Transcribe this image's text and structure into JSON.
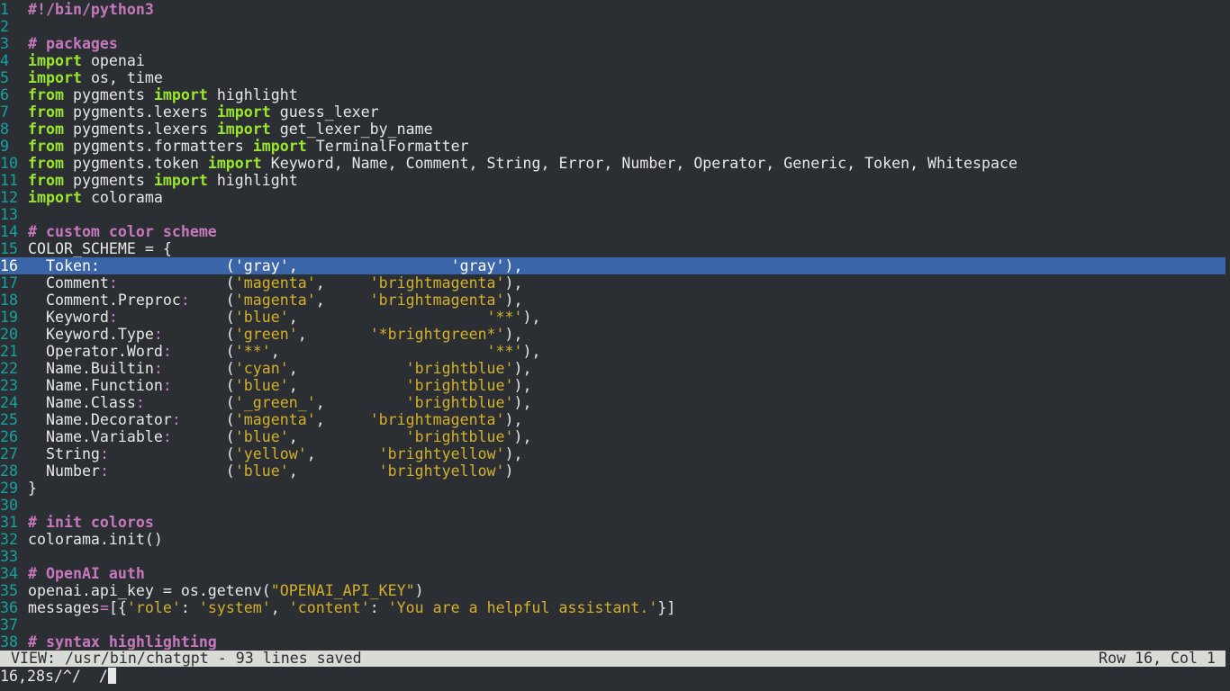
{
  "editor": {
    "current_line": 16,
    "lines": [
      {
        "n": "1",
        "tokens": [
          [
            "comment",
            "#!/bin/python3"
          ]
        ]
      },
      {
        "n": "2",
        "tokens": []
      },
      {
        "n": "3",
        "tokens": [
          [
            "comment",
            "# packages"
          ]
        ]
      },
      {
        "n": "4",
        "tokens": [
          [
            "kw",
            "import"
          ],
          [
            "plain",
            " openai"
          ]
        ]
      },
      {
        "n": "5",
        "tokens": [
          [
            "kw",
            "import"
          ],
          [
            "plain",
            " os, time"
          ]
        ]
      },
      {
        "n": "6",
        "tokens": [
          [
            "kw",
            "from"
          ],
          [
            "plain",
            " pygments "
          ],
          [
            "kw",
            "import"
          ],
          [
            "plain",
            " highlight"
          ]
        ]
      },
      {
        "n": "7",
        "tokens": [
          [
            "kw",
            "from"
          ],
          [
            "plain",
            " pygments.lexers "
          ],
          [
            "kw",
            "import"
          ],
          [
            "plain",
            " guess_lexer"
          ]
        ]
      },
      {
        "n": "8",
        "tokens": [
          [
            "kw",
            "from"
          ],
          [
            "plain",
            " pygments.lexers "
          ],
          [
            "kw",
            "import"
          ],
          [
            "plain",
            " get_lexer_by_name"
          ]
        ]
      },
      {
        "n": "9",
        "tokens": [
          [
            "kw",
            "from"
          ],
          [
            "plain",
            " pygments.formatters "
          ],
          [
            "kw",
            "import"
          ],
          [
            "plain",
            " TerminalFormatter"
          ]
        ]
      },
      {
        "n": "10",
        "tokens": [
          [
            "kw",
            "from"
          ],
          [
            "plain",
            " pygments.token "
          ],
          [
            "kw",
            "import"
          ],
          [
            "plain",
            " Keyword, Name, Comment, String, Error, Number, Operator, Generic, Token, Whitespace"
          ]
        ]
      },
      {
        "n": "11",
        "tokens": [
          [
            "kw",
            "from"
          ],
          [
            "plain",
            " pygments "
          ],
          [
            "kw",
            "import"
          ],
          [
            "plain",
            " highlight"
          ]
        ]
      },
      {
        "n": "12",
        "tokens": [
          [
            "kw",
            "import"
          ],
          [
            "plain",
            " colorama"
          ]
        ]
      },
      {
        "n": "13",
        "tokens": []
      },
      {
        "n": "14",
        "tokens": [
          [
            "comment",
            "# custom color scheme"
          ]
        ]
      },
      {
        "n": "15",
        "tokens": [
          [
            "plain",
            "COLOR_SCHEME = {"
          ]
        ]
      },
      {
        "n": "16",
        "tokens": [
          [
            "plain",
            "  Token:"
          ],
          [
            "plain",
            "              ("
          ],
          [
            "str",
            "'gray'"
          ],
          [
            "plain",
            ",                 "
          ],
          [
            "str",
            "'gray'"
          ],
          [
            "plain",
            "),"
          ]
        ]
      },
      {
        "n": "17",
        "tokens": [
          [
            "plain",
            "  Comment"
          ],
          [
            "punct",
            ":"
          ],
          [
            "plain",
            "            ("
          ],
          [
            "str",
            "'magenta'"
          ],
          [
            "plain",
            ",     "
          ],
          [
            "str",
            "'brightmagenta'"
          ],
          [
            "plain",
            "),"
          ]
        ]
      },
      {
        "n": "18",
        "tokens": [
          [
            "plain",
            "  Comment.Preproc"
          ],
          [
            "punct",
            ":"
          ],
          [
            "plain",
            "    ("
          ],
          [
            "str",
            "'magenta'"
          ],
          [
            "plain",
            ",     "
          ],
          [
            "str",
            "'brightmagenta'"
          ],
          [
            "plain",
            "),"
          ]
        ]
      },
      {
        "n": "19",
        "tokens": [
          [
            "plain",
            "  Keyword"
          ],
          [
            "punct",
            ":"
          ],
          [
            "plain",
            "            ("
          ],
          [
            "str",
            "'blue'"
          ],
          [
            "plain",
            ",                     "
          ],
          [
            "str",
            "'**'"
          ],
          [
            "plain",
            "),"
          ]
        ]
      },
      {
        "n": "20",
        "tokens": [
          [
            "plain",
            "  Keyword.Type"
          ],
          [
            "punct",
            ":"
          ],
          [
            "plain",
            "       ("
          ],
          [
            "str",
            "'green'"
          ],
          [
            "plain",
            ",       "
          ],
          [
            "str",
            "'*brightgreen*'"
          ],
          [
            "plain",
            "),"
          ]
        ]
      },
      {
        "n": "21",
        "tokens": [
          [
            "plain",
            "  Operator.Word"
          ],
          [
            "punct",
            ":"
          ],
          [
            "plain",
            "      ("
          ],
          [
            "str",
            "'**'"
          ],
          [
            "plain",
            ",                       "
          ],
          [
            "str",
            "'**'"
          ],
          [
            "plain",
            "),"
          ]
        ]
      },
      {
        "n": "22",
        "tokens": [
          [
            "plain",
            "  Name.Builtin"
          ],
          [
            "punct",
            ":"
          ],
          [
            "plain",
            "       ("
          ],
          [
            "str",
            "'cyan'"
          ],
          [
            "plain",
            ",            "
          ],
          [
            "str",
            "'brightblue'"
          ],
          [
            "plain",
            "),"
          ]
        ]
      },
      {
        "n": "23",
        "tokens": [
          [
            "plain",
            "  Name.Function"
          ],
          [
            "punct",
            ":"
          ],
          [
            "plain",
            "      ("
          ],
          [
            "str",
            "'blue'"
          ],
          [
            "plain",
            ",            "
          ],
          [
            "str",
            "'brightblue'"
          ],
          [
            "plain",
            "),"
          ]
        ]
      },
      {
        "n": "24",
        "tokens": [
          [
            "plain",
            "  Name.Class"
          ],
          [
            "punct",
            ":"
          ],
          [
            "plain",
            "         ("
          ],
          [
            "str",
            "'_green_'"
          ],
          [
            "plain",
            ",         "
          ],
          [
            "str",
            "'brightblue'"
          ],
          [
            "plain",
            "),"
          ]
        ]
      },
      {
        "n": "25",
        "tokens": [
          [
            "plain",
            "  Name.Decorator"
          ],
          [
            "punct",
            ":"
          ],
          [
            "plain",
            "     ("
          ],
          [
            "str",
            "'magenta'"
          ],
          [
            "plain",
            ",     "
          ],
          [
            "str",
            "'brightmagenta'"
          ],
          [
            "plain",
            "),"
          ]
        ]
      },
      {
        "n": "26",
        "tokens": [
          [
            "plain",
            "  Name.Variable"
          ],
          [
            "punct",
            ":"
          ],
          [
            "plain",
            "      ("
          ],
          [
            "str",
            "'blue'"
          ],
          [
            "plain",
            ",            "
          ],
          [
            "str",
            "'brightblue'"
          ],
          [
            "plain",
            "),"
          ]
        ]
      },
      {
        "n": "27",
        "tokens": [
          [
            "plain",
            "  String"
          ],
          [
            "punct",
            ":"
          ],
          [
            "plain",
            "             ("
          ],
          [
            "str",
            "'yellow'"
          ],
          [
            "plain",
            ",       "
          ],
          [
            "str",
            "'brightyellow'"
          ],
          [
            "plain",
            "),"
          ]
        ]
      },
      {
        "n": "28",
        "tokens": [
          [
            "plain",
            "  Number"
          ],
          [
            "punct",
            ":"
          ],
          [
            "plain",
            "             ("
          ],
          [
            "str",
            "'blue'"
          ],
          [
            "plain",
            ",         "
          ],
          [
            "str",
            "'brightyellow'"
          ],
          [
            "plain",
            ")"
          ]
        ]
      },
      {
        "n": "29",
        "tokens": [
          [
            "plain",
            "}"
          ]
        ]
      },
      {
        "n": "30",
        "tokens": []
      },
      {
        "n": "31",
        "tokens": [
          [
            "comment",
            "# init coloros"
          ]
        ]
      },
      {
        "n": "32",
        "tokens": [
          [
            "plain",
            "colorama.init()"
          ]
        ]
      },
      {
        "n": "33",
        "tokens": []
      },
      {
        "n": "34",
        "tokens": [
          [
            "comment",
            "# OpenAI auth"
          ]
        ]
      },
      {
        "n": "35",
        "tokens": [
          [
            "plain",
            "openai.api_key = os.getenv("
          ],
          [
            "str",
            "\"OPENAI_API_KEY\""
          ],
          [
            "plain",
            ")"
          ]
        ]
      },
      {
        "n": "36",
        "tokens": [
          [
            "plain",
            "messages"
          ],
          [
            "punct",
            "="
          ],
          [
            "plain",
            "[{"
          ],
          [
            "str",
            "'role'"
          ],
          [
            "plain",
            ": "
          ],
          [
            "str",
            "'system'"
          ],
          [
            "plain",
            ", "
          ],
          [
            "str",
            "'content'"
          ],
          [
            "plain",
            ": "
          ],
          [
            "str",
            "'You are a helpful assistant.'"
          ],
          [
            "plain",
            "}]"
          ]
        ]
      },
      {
        "n": "37",
        "tokens": []
      },
      {
        "n": "38",
        "tokens": [
          [
            "comment",
            "# syntax highlighting"
          ]
        ]
      }
    ]
  },
  "status_bar": {
    "left": "VIEW: /usr/bin/chatgpt - 93 lines saved",
    "right": "Row 16, Col 1"
  },
  "command_line": {
    "text": "16,28s/^/  /"
  },
  "colors": {
    "background": "#2b2f33",
    "line_number": "#17a2a2",
    "comment": "#c678bd",
    "keyword": "#9ae62d",
    "string": "#d4b02a",
    "selection": "#3a65a8",
    "status_bar_bg": "#d9dbd6"
  }
}
